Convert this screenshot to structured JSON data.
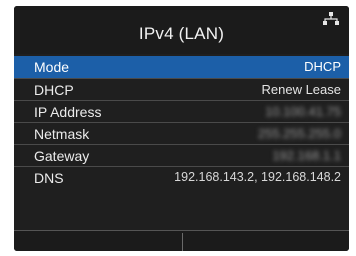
{
  "header": {
    "title": "IPv4 (LAN)",
    "status_icon": "network-icon"
  },
  "menu": {
    "items": [
      {
        "label": "Mode",
        "value": "DHCP",
        "selected": true
      },
      {
        "label": "DHCP",
        "value": "Renew Lease"
      },
      {
        "label": "IP Address",
        "value": "10.100.41.75"
      },
      {
        "label": "Netmask",
        "value": "255.255.255.0"
      },
      {
        "label": "Gateway",
        "value": "192.168.1.1"
      },
      {
        "label": "DNS",
        "value": "192.168.143.2, 192.168.148.2"
      }
    ]
  },
  "colors": {
    "background": "#1f1f1f",
    "selected_row": "#1c5fa8",
    "text": "#ececec"
  }
}
